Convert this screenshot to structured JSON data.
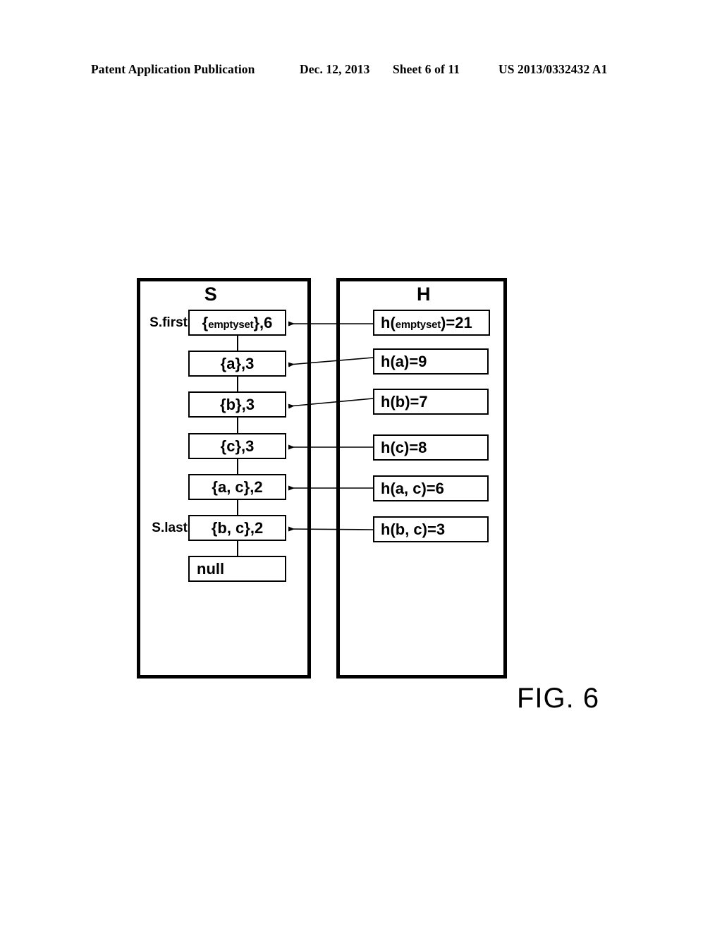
{
  "header": {
    "publication": "Patent Application Publication",
    "date": "Dec. 12, 2013",
    "sheet": "Sheet 6 of 11",
    "patent_number": "US 2013/0332432 A1"
  },
  "figure": {
    "caption": "FIG. 6",
    "columns": {
      "s": {
        "title": "S",
        "first_label": "S.first",
        "last_label": "S.last"
      },
      "h": {
        "title": "H"
      }
    },
    "s_nodes": [
      {
        "prefix": "{",
        "small": "emptyset",
        "suffix": "},6",
        "text": "{emptyset},6"
      },
      {
        "text": "{a},3"
      },
      {
        "text": "{b},3"
      },
      {
        "text": "{c},3"
      },
      {
        "text": "{a, c},2"
      },
      {
        "text": "{b, c},2"
      },
      {
        "text": "null"
      }
    ],
    "h_nodes": [
      {
        "prefix": "h(",
        "small": "emptyset",
        "suffix": ")=21",
        "text": "h(emptyset)=21"
      },
      {
        "text": "h(a)=9"
      },
      {
        "text": "h(b)=7"
      },
      {
        "text": "h(c)=8"
      },
      {
        "text": "h(a, c)=6"
      },
      {
        "text": "h(b, c)=3"
      }
    ]
  },
  "colors": {
    "ink": "#000000",
    "paper": "#ffffff"
  }
}
